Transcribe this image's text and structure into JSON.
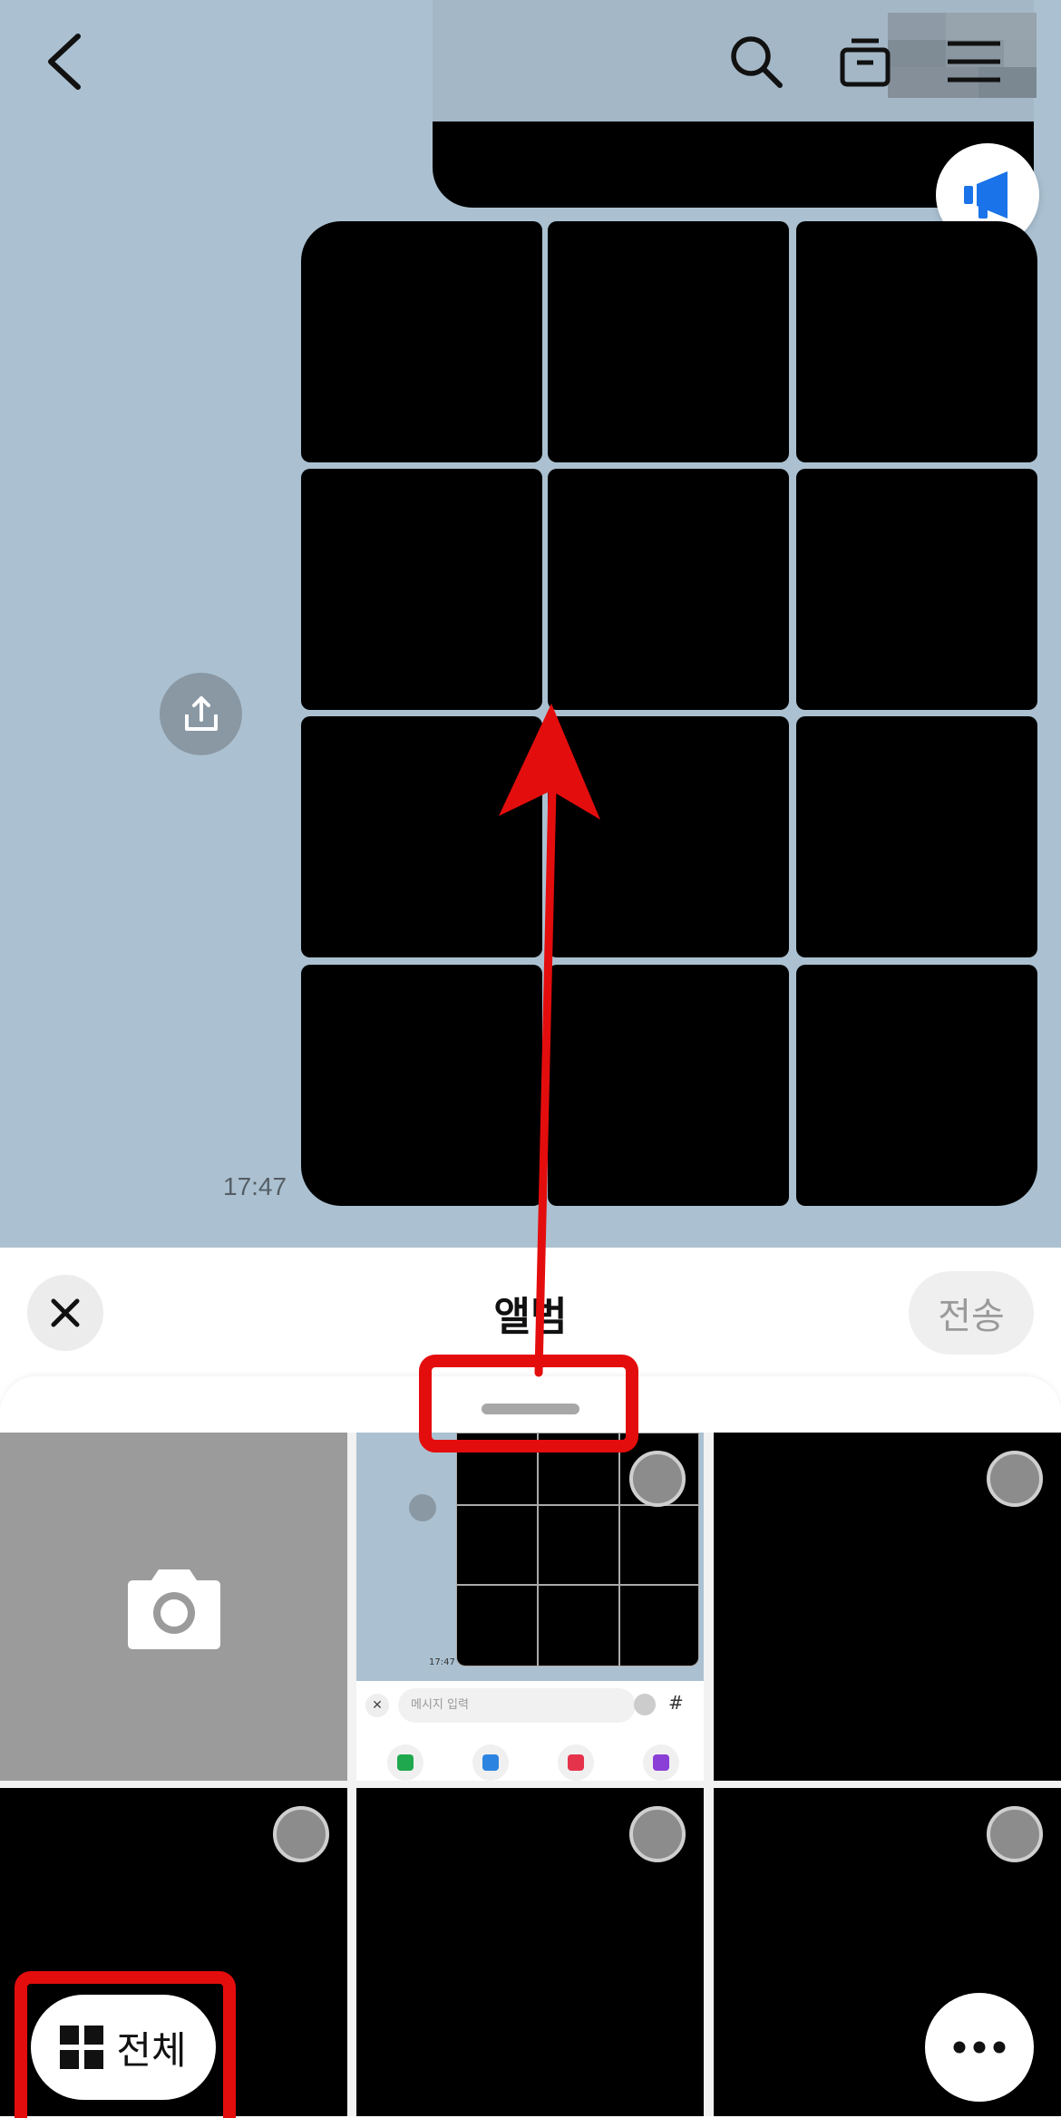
{
  "header": {
    "back_icon": "chevron-left-icon",
    "search_icon": "search-icon",
    "drawer_icon": "drawer-icon",
    "menu_icon": "hamburger-menu-icon"
  },
  "notice_icon": "megaphone-icon",
  "share_icon": "share-upload-icon",
  "message": {
    "time": "17:47",
    "photo_count": 12
  },
  "album": {
    "title": "앨범",
    "send_label": "전송",
    "close_icon": "close-icon",
    "camera_icon": "camera-icon",
    "filter_label": "전체",
    "filter_icon": "grid-icon",
    "more_icon": "more-dots-icon",
    "thumbnail": {
      "time": "17:47",
      "input_placeholder": "메시지 입력",
      "hash": "#"
    }
  },
  "colors": {
    "chat_background": "#abc1d1",
    "annotation_red": "#e40d0d",
    "accent_blue": "#1a73e8"
  }
}
